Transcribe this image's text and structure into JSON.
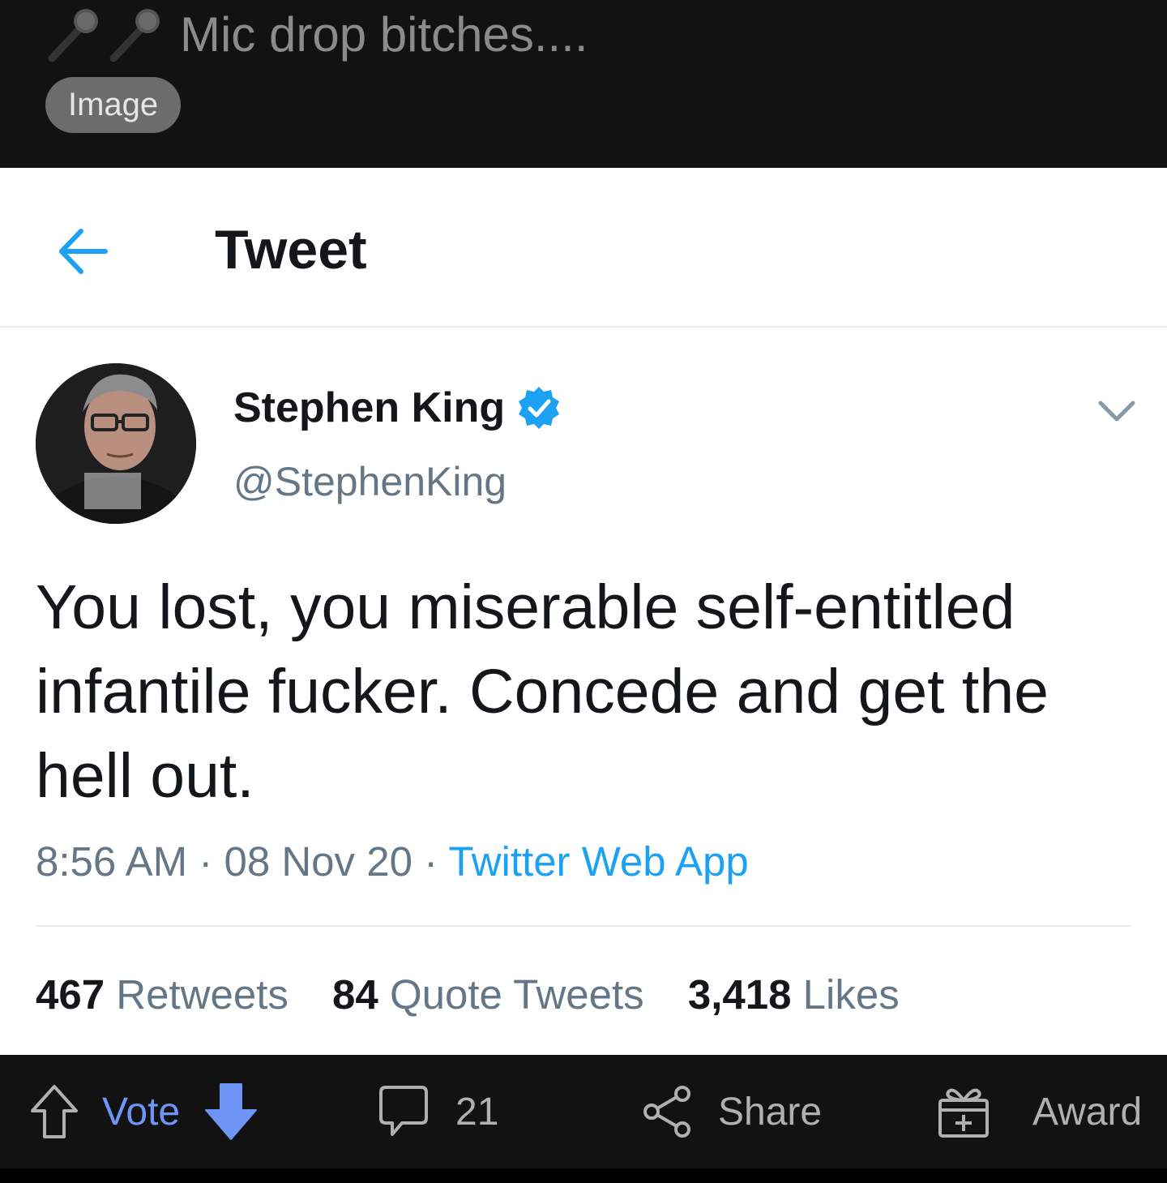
{
  "post": {
    "title": "Mic drop bitches....",
    "title_icons": [
      "microphone-icon",
      "microphone-icon"
    ],
    "flair": "Image"
  },
  "tweet": {
    "header_title": "Tweet",
    "author": {
      "display_name": "Stephen King",
      "handle": "@StephenKing",
      "verified": true
    },
    "text": "You lost, you miserable self-entitled infantile fucker. Concede and get the hell out.",
    "time": "8:56 AM",
    "date": "08 Nov 20",
    "separator": "·",
    "source": "Twitter Web App",
    "stats": {
      "retweets_count": "467",
      "retweets_label": "Retweets",
      "quotes_count": "84",
      "quotes_label": "Quote Tweets",
      "likes_count": "3,418",
      "likes_label": "Likes"
    }
  },
  "actions": {
    "vote_label": "Vote",
    "comments_count": "21",
    "share_label": "Share",
    "award_label": "Award"
  },
  "colors": {
    "twitter_blue": "#1da1f2",
    "reddit_vote_blue": "#6e95f5",
    "dark_bg": "#121212"
  }
}
